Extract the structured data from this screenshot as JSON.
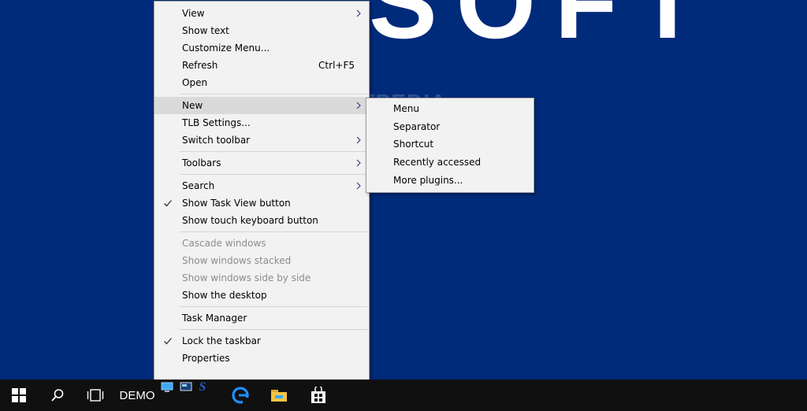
{
  "desktop": {
    "background_color": "#002a7a",
    "logo_text": "SOFT",
    "watermark": "SOFTPEDIA"
  },
  "context_menu": {
    "groups": [
      [
        {
          "label": "View",
          "submenu": true
        },
        {
          "label": "Show text"
        },
        {
          "label": "Customize Menu..."
        },
        {
          "label": "Refresh",
          "shortcut": "Ctrl+F5"
        },
        {
          "label": "Open"
        }
      ],
      [
        {
          "label": "New",
          "submenu": true,
          "highlighted": true
        },
        {
          "label": "TLB Settings..."
        },
        {
          "label": "Switch toolbar",
          "submenu": true
        }
      ],
      [
        {
          "label": "Toolbars",
          "submenu": true
        }
      ],
      [
        {
          "label": "Search",
          "submenu": true
        },
        {
          "label": "Show Task View button",
          "checked": true
        },
        {
          "label": "Show touch keyboard button"
        }
      ],
      [
        {
          "label": "Cascade windows",
          "disabled": true
        },
        {
          "label": "Show windows stacked",
          "disabled": true
        },
        {
          "label": "Show windows side by side",
          "disabled": true
        },
        {
          "label": "Show the desktop"
        }
      ],
      [
        {
          "label": "Task Manager"
        }
      ],
      [
        {
          "label": "Lock the taskbar",
          "checked": true
        },
        {
          "label": "Properties"
        }
      ]
    ]
  },
  "new_submenu": {
    "items": [
      {
        "label": "Menu"
      },
      {
        "label": "Separator"
      },
      {
        "label": "Shortcut"
      },
      {
        "label": "Recently accessed"
      },
      {
        "label": "More plugins..."
      }
    ]
  },
  "taskbar": {
    "background_color": "#101010",
    "toolbar_label": "DEMO",
    "buttons": [
      {
        "name": "start",
        "icon": "windows-logo-icon"
      },
      {
        "name": "search",
        "icon": "search-icon"
      },
      {
        "name": "task-view",
        "icon": "task-view-icon"
      },
      {
        "name": "edge",
        "icon": "edge-icon",
        "accent": "#1e90ff"
      },
      {
        "name": "file-explorer",
        "icon": "folder-icon",
        "accent": "#f4c542"
      },
      {
        "name": "store",
        "icon": "store-icon"
      }
    ]
  }
}
